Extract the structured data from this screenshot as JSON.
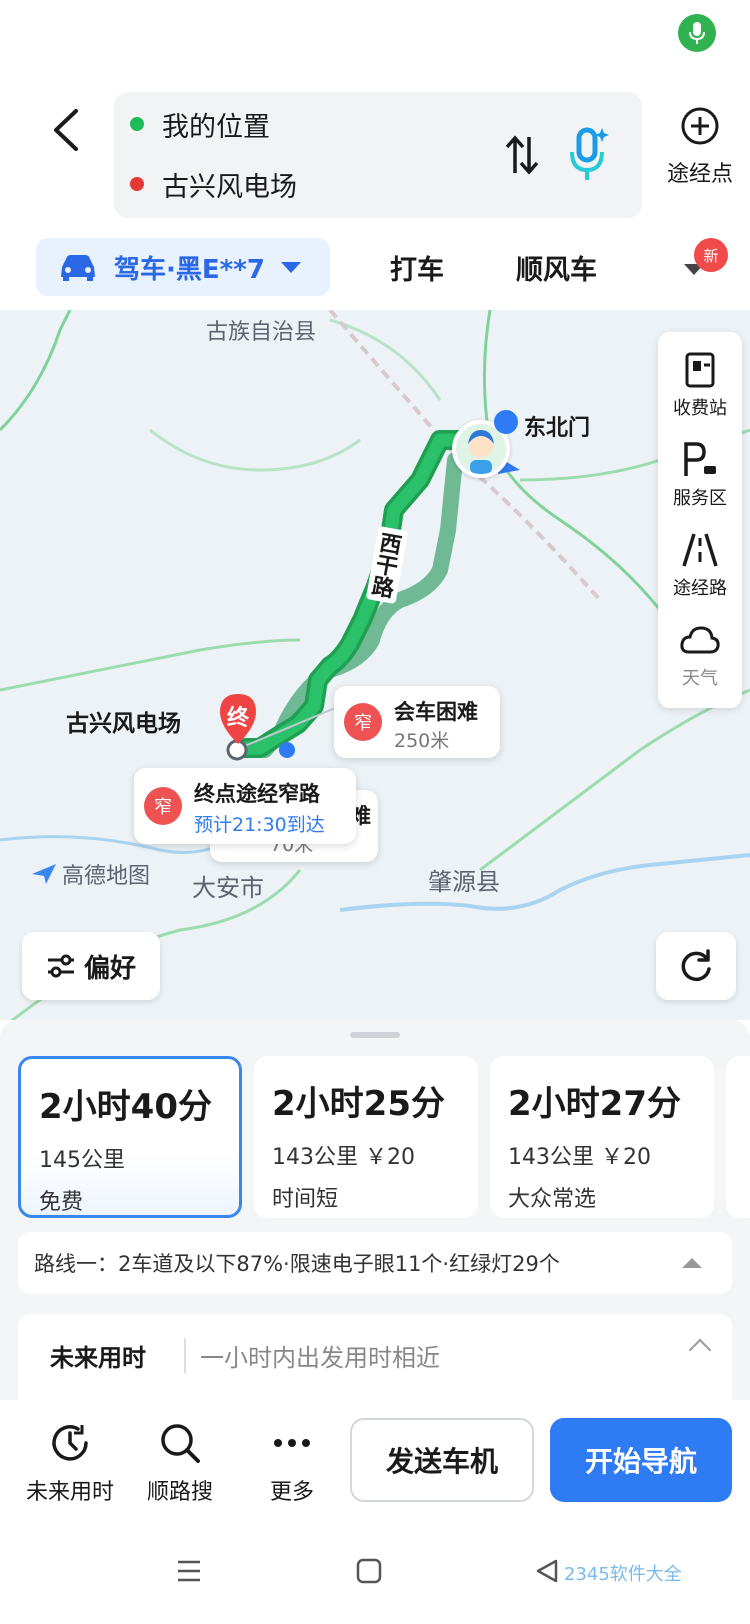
{
  "header": {
    "origin": "我的位置",
    "destination": "古兴风电场",
    "waypoint_label": "途经点",
    "colors": {
      "origin_dot": "#1fba5a",
      "destination_dot": "#e53935",
      "accent": "#2a68e6"
    }
  },
  "modes": {
    "drive_label": "驾车·黑E**7",
    "taxi_label": "打车",
    "carpool_label": "顺风车",
    "new_badge": "新"
  },
  "map": {
    "labels": {
      "county_top": "古族自治县",
      "northeast_gate": "东北门",
      "road_name": "西干路",
      "destination_name": "古兴风电场",
      "city": "大安市",
      "county_right": "肇源县",
      "destination_marker": "终",
      "logo": "高德地图"
    },
    "tools": [
      {
        "label": "收费站",
        "icon": "toll-station-icon"
      },
      {
        "label": "服务区",
        "icon": "service-area-icon"
      },
      {
        "label": "途经路",
        "icon": "road-icon"
      },
      {
        "label": "天气",
        "icon": "weather-icon"
      }
    ],
    "callouts": {
      "meet": {
        "badge": "窄",
        "title": "会车困难",
        "distance": "250米"
      },
      "end": {
        "badge": "窄",
        "title": "终点途经窄路",
        "eta": "预计21:30到达"
      },
      "behind": {
        "title_partial": "难",
        "distance": "70米"
      }
    },
    "preference_label": "偏好"
  },
  "routes": [
    {
      "time": "2小时40分",
      "distance": "145公里",
      "toll": "",
      "tag": "免费",
      "active": true
    },
    {
      "time": "2小时25分",
      "distance": "143公里",
      "toll": "￥20",
      "tag": "时间短",
      "active": false
    },
    {
      "time": "2小时27分",
      "distance": "143公里",
      "toll": "￥20",
      "tag": "大众常选",
      "active": false
    }
  ],
  "route_detail": "路线一：2车道及以下87%·限速电子眼11个·红绿灯29个",
  "future": {
    "title": "未来用时",
    "subtitle": "一小时内出发用时相近"
  },
  "actions": {
    "future_time": "未来用时",
    "along_search": "顺路搜",
    "more": "更多",
    "send_to_car": "发送车机",
    "start_nav": "开始导航"
  },
  "watermark": "2345软件大全"
}
